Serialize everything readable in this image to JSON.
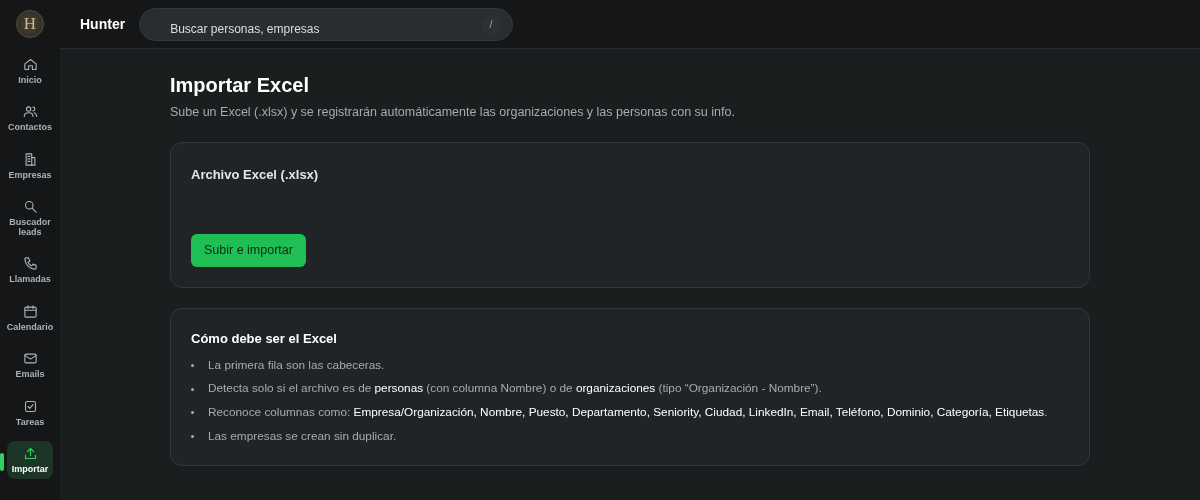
{
  "logo": {
    "letter": "H"
  },
  "app_name": "Hunter",
  "search": {
    "placeholder": "Buscar personas, empresas",
    "shortcut": "/"
  },
  "sidebar": {
    "items": [
      {
        "label": "Inicio",
        "selected": false
      },
      {
        "label": "Contactos",
        "selected": false
      },
      {
        "label": "Empresas",
        "selected": false
      },
      {
        "label": "Buscador leads",
        "selected": false
      },
      {
        "label": "Llamadas",
        "selected": false
      },
      {
        "label": "Calendario",
        "selected": false
      },
      {
        "label": "Emails",
        "selected": false
      },
      {
        "label": "Tareas",
        "selected": false
      },
      {
        "label": "Importar",
        "selected": true
      }
    ]
  },
  "page": {
    "title": "Importar Excel",
    "subtitle": "Sube un Excel (.xlsx) y se registrarán automáticamente las organizaciones y las personas con su info."
  },
  "upload_card": {
    "label": "Archivo Excel (.xlsx)",
    "button": "Subir e importar"
  },
  "help_card": {
    "title": "Cómo debe ser el Excel",
    "items": [
      "La primera fila son las cabeceras.",
      "Detecta solo si el archivo es de **personas** (con columna Nombre) o de **organizaciones** (tipo “Organización - Nombre”).",
      "Reconoce columnas como: **Empresa/Organización, Nombre, Puesto, Departamento, Seniority, Ciudad, LinkedIn, Email, Teléfono, Dominio, Categoría, Etiquetas**.",
      "Las empresas se crean sin duplicar."
    ]
  }
}
